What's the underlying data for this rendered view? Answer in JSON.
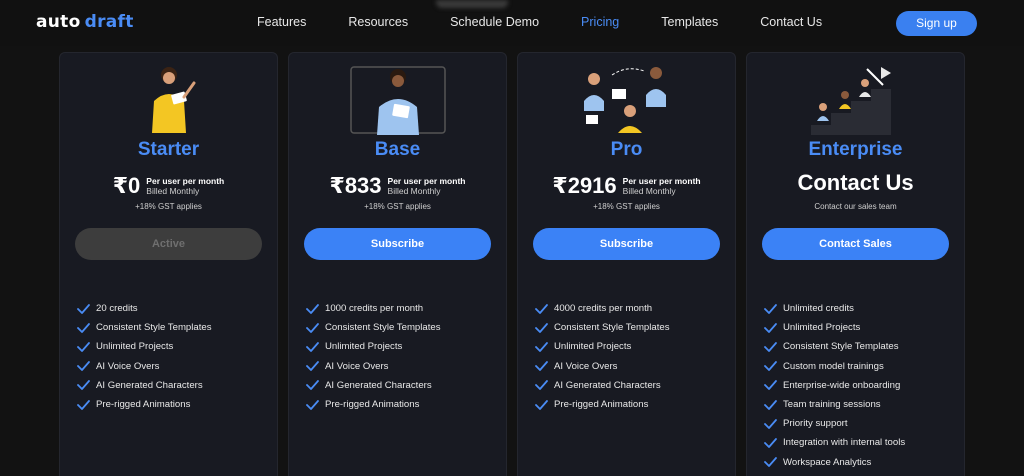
{
  "nav": {
    "logo": {
      "word1": "auto",
      "word2": "draft"
    },
    "links": [
      "Features",
      "Resources",
      "Schedule Demo",
      "Pricing",
      "Templates",
      "Contact Us"
    ],
    "active_link": "Pricing",
    "signup_label": "Sign up"
  },
  "colors": {
    "accent": "#4a8cf5",
    "button": "#3b82f6",
    "card_bg": "#181a22",
    "page_bg": "#121212"
  },
  "plans": [
    {
      "name": "Starter",
      "price": "₹0",
      "per_line1": "Per user per month",
      "per_line2": "Billed Monthly",
      "gst": "+18% GST applies",
      "cta": "Active",
      "features": [
        "20 credits",
        "Consistent Style Templates",
        "Unlimited Projects",
        "AI Voice Overs",
        "AI Generated Characters",
        "Pre-rigged Animations"
      ]
    },
    {
      "name": "Base",
      "price": "₹833",
      "per_line1": "Per user per month",
      "per_line2": "Billed Monthly",
      "gst": "+18% GST applies",
      "cta": "Subscribe",
      "features": [
        "1000 credits per month",
        "Consistent Style Templates",
        "Unlimited Projects",
        "AI Voice Overs",
        "AI Generated Characters",
        "Pre-rigged Animations"
      ]
    },
    {
      "name": "Pro",
      "price": "₹2916",
      "per_line1": "Per user per month",
      "per_line2": "Billed Monthly",
      "gst": "+18% GST applies",
      "cta": "Subscribe",
      "features": [
        "4000 credits per month",
        "Consistent Style Templates",
        "Unlimited Projects",
        "AI Voice Overs",
        "AI Generated Characters",
        "Pre-rigged Animations"
      ]
    },
    {
      "name": "Enterprise",
      "headline": "Contact Us",
      "gst": "Contact our sales team",
      "cta": "Contact Sales",
      "features": [
        "Unlimited credits",
        "Unlimited Projects",
        "Consistent Style Templates",
        "Custom model trainings",
        "Enterprise-wide onboarding",
        "Team training sessions",
        "Priority support",
        "Integration with internal tools",
        "Workspace Analytics"
      ]
    }
  ]
}
